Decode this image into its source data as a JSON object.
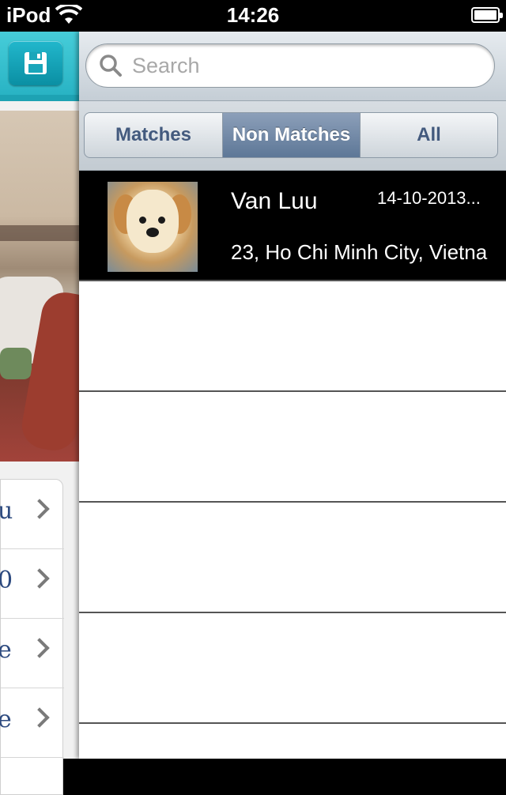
{
  "status_bar": {
    "carrier": "iPod",
    "time": "14:26"
  },
  "search": {
    "placeholder": "Search"
  },
  "segments": [
    {
      "label": "Matches",
      "active": false
    },
    {
      "label": "Non Matches",
      "active": true
    },
    {
      "label": "All",
      "active": false
    }
  ],
  "results": [
    {
      "name": "Van Luu",
      "date": "14-10-2013...",
      "detail": "23, Ho Chi Minh City, Vietna"
    }
  ],
  "left_menu": {
    "items": [
      {
        "label": "u"
      },
      {
        "label": "0"
      },
      {
        "label": "e"
      },
      {
        "label": "e"
      }
    ]
  },
  "colors": {
    "header_teal": "#2fbccb",
    "segment_active": "#6e86a6",
    "segment_text": "#435a7e"
  }
}
